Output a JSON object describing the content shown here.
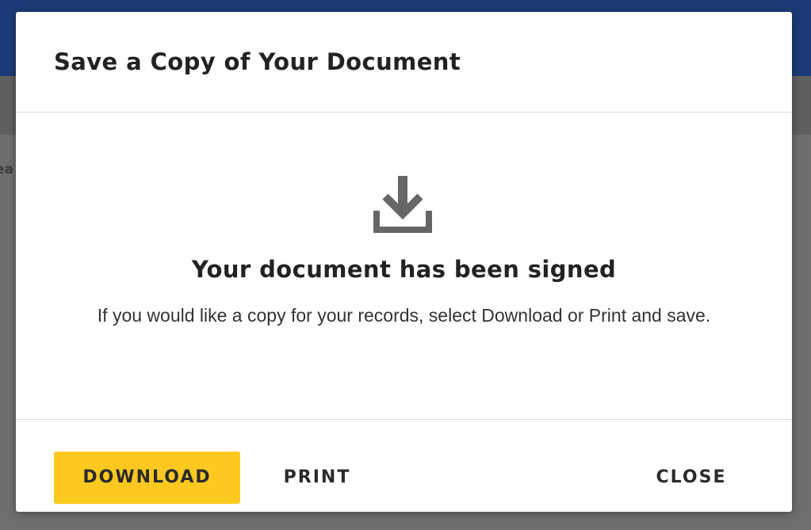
{
  "background": {
    "partial_text": "ea"
  },
  "dialog": {
    "title": "Save a Copy of Your Document",
    "icon": "download-icon",
    "heading": "Your document has been signed",
    "message": "If you would like a copy for your records, select Download or Print and save.",
    "buttons": {
      "download": "DOWNLOAD",
      "print": "PRINT",
      "close": "CLOSE"
    }
  },
  "colors": {
    "header_blue": "#1c3a75",
    "accent_yellow": "#fdc921",
    "icon_gray": "#666666"
  }
}
